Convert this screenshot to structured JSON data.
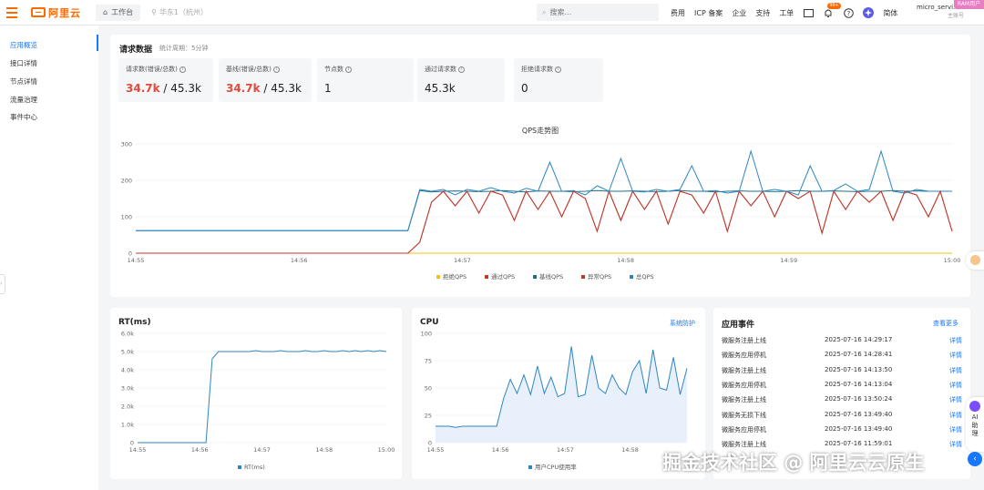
{
  "header": {
    "logo_text": "阿里云",
    "workspace_tab": "工作台",
    "region_text": "华东1（杭州）",
    "search_placeholder": "搜索...",
    "links": [
      "费用",
      "ICP 备案",
      "企业",
      "支持",
      "工单"
    ],
    "notification_badge": "99+",
    "language": "简体",
    "user_name": "micro_servi...",
    "user_sub": "主账号",
    "user_tag": "RAM用户"
  },
  "sidebar": {
    "items": [
      {
        "label": "应用概览",
        "active": true
      },
      {
        "label": "接口详情",
        "active": false
      },
      {
        "label": "节点详情",
        "active": false
      },
      {
        "label": "流量治理",
        "active": false
      },
      {
        "label": "事件中心",
        "active": false
      }
    ]
  },
  "request_data": {
    "title": "请求数据",
    "period": "统计周期：5分钟",
    "stats": [
      {
        "label": "请求数(错误/总数)",
        "error": "34.7k",
        "total": "/ 45.3k"
      },
      {
        "label": "基线(错误/总数)",
        "error": "34.7k",
        "total": "/ 45.3k"
      },
      {
        "label": "节点数",
        "error": "",
        "total": "1"
      },
      {
        "label": "通过请求数",
        "error": "",
        "total": "45.3k"
      },
      {
        "label": "拒绝请求数",
        "error": "",
        "total": "0"
      }
    ]
  },
  "colors": {
    "red": "#c0392b",
    "blue": "#2e86c1",
    "yellow": "#f1c40f",
    "teal": "#1f6f8b",
    "cpu_fill": "#e8f0fb",
    "link": "#1677ff"
  },
  "chart_data": [
    {
      "type": "line",
      "title": "QPS走势图",
      "x_ticks": [
        "14:55",
        "14:56",
        "14:57",
        "14:58",
        "14:59",
        "15:00"
      ],
      "y_ticks": [
        "0",
        "100",
        "200",
        "300"
      ],
      "ylim": [
        0,
        300
      ],
      "legend": "bottom",
      "series": [
        {
          "name": "拒绝QPS",
          "color": "#f1c40f",
          "values": [
            0,
            0,
            0,
            0,
            0,
            0,
            0,
            0,
            0,
            0,
            0,
            0,
            0,
            0,
            0,
            0,
            0,
            0,
            0,
            0,
            0,
            0,
            0,
            0,
            0,
            0,
            0,
            0,
            0,
            0,
            0,
            0,
            0,
            0,
            0,
            0,
            0,
            0,
            0,
            0,
            0,
            0,
            0,
            0,
            0,
            0,
            0,
            0,
            0,
            0,
            0,
            0,
            0,
            0,
            0,
            0,
            0,
            0,
            0,
            0,
            0,
            0,
            0,
            0,
            0,
            0,
            0,
            0,
            0,
            0
          ]
        },
        {
          "name": "通过QPS",
          "color": "#c0392b",
          "values": [
            0,
            0,
            0,
            0,
            0,
            0,
            0,
            0,
            0,
            0,
            0,
            0,
            0,
            0,
            0,
            0,
            0,
            0,
            0,
            0,
            0,
            0,
            0,
            0,
            30,
            140,
            170,
            130,
            170,
            110,
            170,
            160,
            90,
            170,
            120,
            170,
            100,
            170,
            150,
            60,
            170,
            90,
            170,
            120,
            170,
            80,
            170,
            160,
            110,
            170,
            60,
            170,
            130,
            170,
            100,
            170,
            150,
            170,
            55,
            170,
            120,
            170,
            140,
            170,
            90,
            170,
            160,
            100,
            170,
            60
          ]
        },
        {
          "name": "基线QPS",
          "color": "#1f6f8b",
          "values": [
            62,
            62,
            62,
            62,
            62,
            62,
            62,
            62,
            62,
            62,
            62,
            62,
            62,
            62,
            62,
            62,
            62,
            62,
            62,
            62,
            62,
            62,
            62,
            62,
            172,
            168,
            170,
            171,
            170,
            169,
            170,
            172,
            170,
            168,
            171,
            170,
            170,
            169,
            170,
            172,
            170,
            170,
            171,
            170,
            169,
            170,
            172,
            170,
            170,
            168,
            170,
            171,
            170,
            170,
            169,
            170,
            172,
            170,
            170,
            171,
            170,
            169,
            170,
            170,
            172,
            170,
            171,
            170,
            170,
            170
          ]
        },
        {
          "name": "异常QPS",
          "color": "#c0392b",
          "values": [
            0,
            0,
            0,
            0,
            0,
            0,
            0,
            0,
            0,
            0,
            0,
            0,
            0,
            0,
            0,
            0,
            0,
            0,
            0,
            0,
            0,
            0,
            0,
            0,
            30,
            140,
            170,
            130,
            170,
            110,
            170,
            160,
            90,
            170,
            120,
            170,
            100,
            170,
            150,
            60,
            170,
            90,
            170,
            120,
            170,
            80,
            170,
            160,
            110,
            170,
            60,
            170,
            130,
            170,
            100,
            170,
            150,
            170,
            55,
            170,
            120,
            170,
            140,
            170,
            90,
            170,
            160,
            100,
            170,
            60
          ]
        },
        {
          "name": "总QPS",
          "color": "#2e86c1",
          "values": [
            62,
            62,
            62,
            62,
            62,
            62,
            62,
            62,
            62,
            62,
            62,
            62,
            62,
            62,
            62,
            62,
            62,
            62,
            62,
            62,
            62,
            62,
            62,
            62,
            175,
            170,
            175,
            160,
            175,
            170,
            180,
            170,
            165,
            178,
            170,
            250,
            170,
            172,
            160,
            185,
            170,
            260,
            170,
            168,
            175,
            170,
            175,
            240,
            170,
            172,
            165,
            170,
            280,
            170,
            175,
            170,
            160,
            240,
            170,
            172,
            190,
            170,
            175,
            280,
            170,
            165,
            175,
            170,
            170,
            170
          ]
        }
      ]
    },
    {
      "type": "line",
      "title": "RT(ms)",
      "x_ticks": [
        "14:55",
        "14:56",
        "14:57",
        "14:58",
        "15:00"
      ],
      "y_ticks": [
        "0",
        "1.0k",
        "2.0k",
        "3.0k",
        "4.0k",
        "5.0k",
        "6.0k"
      ],
      "ylim": [
        0,
        6000
      ],
      "legend": "bottom",
      "series": [
        {
          "name": "RT(ms)",
          "color": "#2e86c1",
          "values": [
            0,
            0,
            0,
            0,
            0,
            0,
            0,
            0,
            0,
            0,
            0,
            0,
            4600,
            5000,
            5000,
            5000,
            5000,
            5000,
            5000,
            5050,
            5000,
            5000,
            5000,
            5050,
            5000,
            5000,
            5000,
            5050,
            5000,
            5000,
            5050,
            5000,
            5000,
            5050,
            5000,
            5050,
            5000,
            5050,
            5000,
            5050,
            5000
          ]
        }
      ]
    },
    {
      "type": "area",
      "title": "CPU",
      "x_ticks": [
        "14:55",
        "14:56",
        "14:57",
        "14:58"
      ],
      "y_ticks": [
        "0",
        "25",
        "50",
        "75",
        "100"
      ],
      "ylim": [
        0,
        100
      ],
      "legend": "bottom",
      "series": [
        {
          "name": "用户CPU使用率",
          "color": "#2e86c1",
          "values": [
            15,
            15,
            15,
            14,
            15,
            15,
            15,
            15,
            15,
            15,
            40,
            58,
            45,
            62,
            44,
            70,
            45,
            60,
            42,
            45,
            88,
            42,
            44,
            80,
            50,
            45,
            62,
            50,
            44,
            65,
            75,
            45,
            85,
            50,
            48,
            78,
            44,
            68
          ]
        }
      ]
    }
  ],
  "rt_panel": {
    "title": "RT(ms)",
    "legend": "RT(ms)"
  },
  "cpu_panel": {
    "title": "CPU",
    "action": "系统防护",
    "legend": "用户CPU使用率"
  },
  "events": {
    "title": "应用事件",
    "more": "查看更多",
    "detail_label": "详情",
    "rows": [
      {
        "name": "微服务注册上线",
        "time": "2025-07-16 14:29:17"
      },
      {
        "name": "微服务应用停机",
        "time": "2025-07-16 14:28:41"
      },
      {
        "name": "微服务注册上线",
        "time": "2025-07-16 14:13:50"
      },
      {
        "name": "微服务应用停机",
        "time": "2025-07-16 14:13:04"
      },
      {
        "name": "微服务注册上线",
        "time": "2025-07-16 13:50:24"
      },
      {
        "name": "微服务无损下线",
        "time": "2025-07-16 13:49:40"
      },
      {
        "name": "微服务应用停机",
        "time": "2025-07-16 13:49:40"
      },
      {
        "name": "微服务注册上线",
        "time": "2025-07-16 11:59:01"
      }
    ]
  },
  "floating": {
    "ai_label": "AI助理"
  },
  "watermark": "掘金技术社区 @ 阿里云云原生"
}
